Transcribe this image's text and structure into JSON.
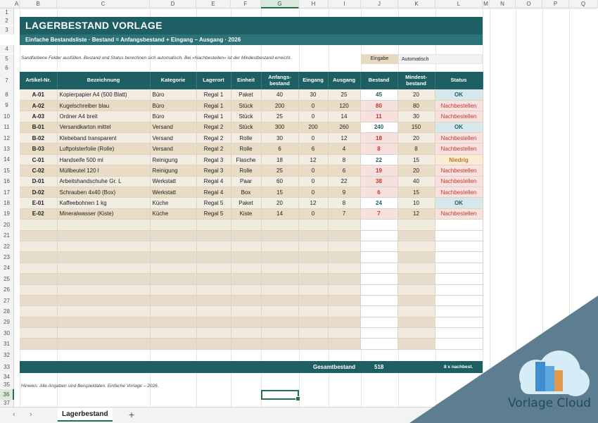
{
  "columns": [
    "A",
    "B",
    "C",
    "D",
    "E",
    "F",
    "G",
    "H",
    "I",
    "J",
    "K",
    "L",
    "M",
    "N",
    "O",
    "P",
    "Q"
  ],
  "rows": [
    "1",
    "2",
    "3",
    "4",
    "5",
    "6",
    "7",
    "8",
    "9",
    "10",
    "11",
    "12",
    "13",
    "14",
    "15",
    "16",
    "17",
    "18",
    "19",
    "20",
    "21",
    "22",
    "23",
    "24",
    "25",
    "26",
    "27",
    "28",
    "29",
    "30",
    "31",
    "32",
    "33",
    "34",
    "35",
    "36",
    "37"
  ],
  "sheet": {
    "title": "LAGERBESTAND VORLAGE",
    "subtitle": "Einfache Bestandsliste  ·  Bestand = Anfangsbestand + Eingang – Ausgang  ·  2026",
    "hint": "Sandfarbene Felder ausfüllen. Bestand und Status berechnen sich automatisch. Bei »Nachbestellen« ist der Mindestbestand erreicht.",
    "legend": {
      "input": "Eingabe",
      "auto": "Automatisch"
    },
    "headers": [
      "Artikel-Nr.",
      "Bezeichnung",
      "Kategorie",
      "Lagerort",
      "Einheit",
      "Anfangs-\nbestand",
      "Eingang",
      "Ausgang",
      "Bestand",
      "Mindest-\nbestand",
      "Status"
    ],
    "items": [
      {
        "nr": "A-01",
        "name": "Kopierpapier A4 (500 Blatt)",
        "kat": "Büro",
        "ort": "Regal 1",
        "einheit": "Paket",
        "anf": "40",
        "ein": "30",
        "aus": "25",
        "best": "45",
        "min": "20",
        "status": "OK",
        "st": "ok"
      },
      {
        "nr": "A-02",
        "name": "Kugelschreiber blau",
        "kat": "Büro",
        "ort": "Regal 1",
        "einheit": "Stück",
        "anf": "200",
        "ein": "0",
        "aus": "120",
        "best": "80",
        "min": "80",
        "status": "Nachbestellen",
        "st": "nb"
      },
      {
        "nr": "A-03",
        "name": "Ordner A4 breit",
        "kat": "Büro",
        "ort": "Regal 1",
        "einheit": "Stück",
        "anf": "25",
        "ein": "0",
        "aus": "14",
        "best": "11",
        "min": "30",
        "status": "Nachbestellen",
        "st": "nb"
      },
      {
        "nr": "B-01",
        "name": "Versandkarton mittel",
        "kat": "Versand",
        "ort": "Regal 2",
        "einheit": "Stück",
        "anf": "300",
        "ein": "200",
        "aus": "260",
        "best": "240",
        "min": "150",
        "status": "OK",
        "st": "ok"
      },
      {
        "nr": "B-02",
        "name": "Klebeband transparent",
        "kat": "Versand",
        "ort": "Regal 2",
        "einheit": "Rolle",
        "anf": "30",
        "ein": "0",
        "aus": "12",
        "best": "18",
        "min": "20",
        "status": "Nachbestellen",
        "st": "nb"
      },
      {
        "nr": "B-03",
        "name": "Luftpolsterfolie (Rolle)",
        "kat": "Versand",
        "ort": "Regal 2",
        "einheit": "Rolle",
        "anf": "6",
        "ein": "6",
        "aus": "4",
        "best": "8",
        "min": "8",
        "status": "Nachbestellen",
        "st": "nb"
      },
      {
        "nr": "C-01",
        "name": "Handseife 500 ml",
        "kat": "Reinigung",
        "ort": "Regal 3",
        "einheit": "Flasche",
        "anf": "18",
        "ein": "12",
        "aus": "8",
        "best": "22",
        "min": "15",
        "status": "Niedrig",
        "st": "ni"
      },
      {
        "nr": "C-02",
        "name": "Müllbeutel 120 l",
        "kat": "Reinigung",
        "ort": "Regal 3",
        "einheit": "Rolle",
        "anf": "25",
        "ein": "0",
        "aus": "6",
        "best": "19",
        "min": "20",
        "status": "Nachbestellen",
        "st": "nb"
      },
      {
        "nr": "D-01",
        "name": "Arbeitshandschuhe Gr. L",
        "kat": "Werkstatt",
        "ort": "Regal 4",
        "einheit": "Paar",
        "anf": "60",
        "ein": "0",
        "aus": "22",
        "best": "38",
        "min": "40",
        "status": "Nachbestellen",
        "st": "nb"
      },
      {
        "nr": "D-02",
        "name": "Schrauben 4x40 (Box)",
        "kat": "Werkstatt",
        "ort": "Regal 4",
        "einheit": "Box",
        "anf": "15",
        "ein": "0",
        "aus": "9",
        "best": "6",
        "min": "15",
        "status": "Nachbestellen",
        "st": "nb"
      },
      {
        "nr": "E-01",
        "name": "Kaffeebohnen 1 kg",
        "kat": "Küche",
        "ort": "Regal 5",
        "einheit": "Paket",
        "anf": "20",
        "ein": "12",
        "aus": "8",
        "best": "24",
        "min": "10",
        "status": "OK",
        "st": "ok"
      },
      {
        "nr": "E-02",
        "name": "Mineralwasser (Kiste)",
        "kat": "Küche",
        "ort": "Regal 5",
        "einheit": "Kiste",
        "anf": "14",
        "ein": "0",
        "aus": "7",
        "best": "7",
        "min": "12",
        "status": "Nachbestellen",
        "st": "nb"
      }
    ],
    "totals": {
      "label": "Gesamtbestand",
      "value": "518",
      "reorder": "8 x nachbest."
    },
    "note": "Hinweis: Alle Angaben sind Beispieldaten. Einfache Vorlage – 2026."
  },
  "tabs": {
    "active": "Lagerbestand",
    "prev": "‹",
    "next": "›",
    "add": "+"
  },
  "brand": {
    "text": "Vorlage Cloud"
  },
  "colors": {
    "header": "#1d5f63",
    "subheader": "#2c7378",
    "sand_odd": "#f3ece2",
    "sand_even": "#e9dcc5",
    "alert": "#c0392b",
    "ok": "#1d5f63",
    "warn": "#c17a1d",
    "corner": "#5d7d90"
  }
}
